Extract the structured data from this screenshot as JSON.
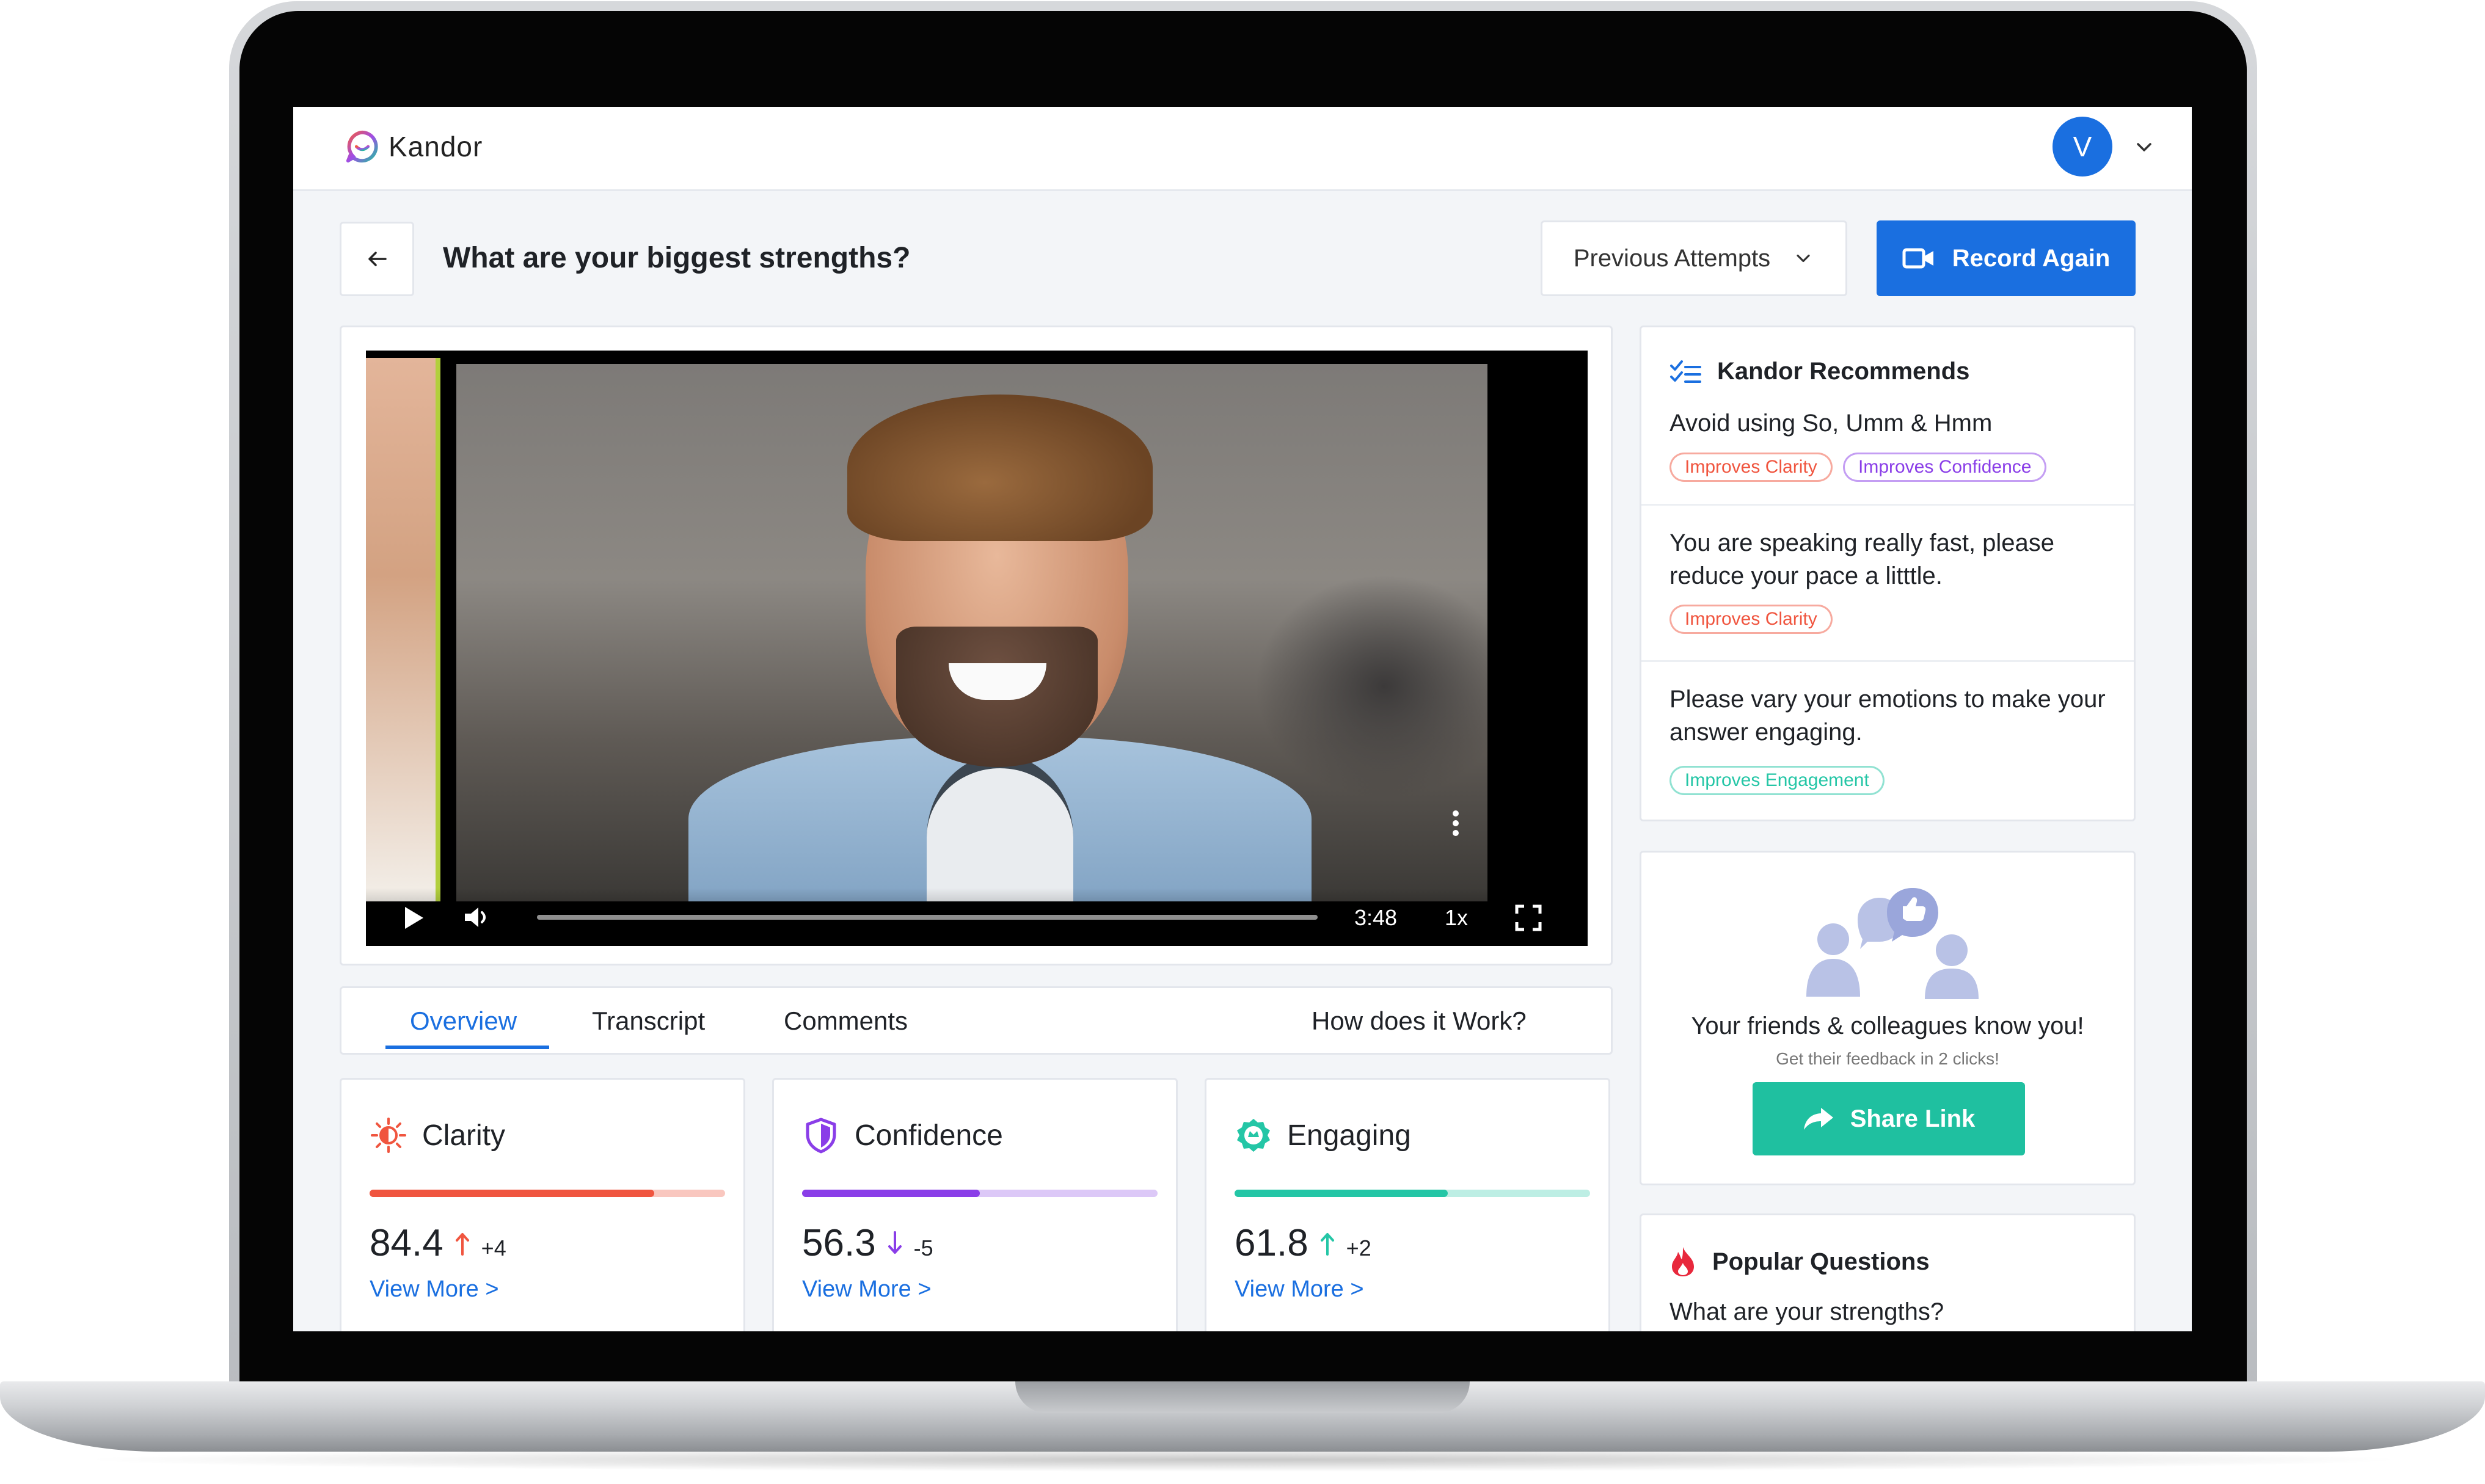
{
  "app": {
    "name": "Kandor",
    "user_initial": "V"
  },
  "header": {
    "question": "What are your biggest strengths?",
    "previous_attempts_label": "Previous Attempts",
    "record_again_label": "Record Again"
  },
  "video": {
    "time": "3:48",
    "speed": "1x"
  },
  "tabs": [
    {
      "label": "Overview",
      "active": true
    },
    {
      "label": "Transcript",
      "active": false
    },
    {
      "label": "Comments",
      "active": false
    },
    {
      "label": "How does it Work?",
      "active": false
    }
  ],
  "metrics": [
    {
      "name": "Clarity",
      "score": "84.4",
      "trend": "up",
      "delta": "+4",
      "bar_fraction": 0.8,
      "color": "#f0553f",
      "track_color": "#f9c7bf",
      "arrow_color": "#f0553f",
      "link": "View More >"
    },
    {
      "name": "Confidence",
      "score": "56.3",
      "trend": "down",
      "delta": "-5",
      "bar_fraction": 0.5,
      "color": "#8a3ee8",
      "track_color": "#dcc8f7",
      "arrow_color": "#8a3ee8",
      "link": "View More >"
    },
    {
      "name": "Engaging",
      "score": "61.8",
      "trend": "up",
      "delta": "+2",
      "bar_fraction": 0.6,
      "color": "#24c6a6",
      "track_color": "#bdeee4",
      "arrow_color": "#24c6a6",
      "link": "View More >"
    }
  ],
  "recommendations": {
    "title": "Kandor Recommends",
    "items": [
      {
        "text": "Avoid using So, Umm & Hmm",
        "tags": [
          {
            "label": "Improves Clarity",
            "color": "#f0553f"
          },
          {
            "label": "Improves Confidence",
            "color": "#8a3ee8"
          }
        ]
      },
      {
        "text": "You are speaking really fast, please reduce your pace a litttle.",
        "tags": [
          {
            "label": "Improves Clarity",
            "color": "#f0553f"
          }
        ]
      },
      {
        "text": "Please vary your emotions to make your answer engaging.",
        "tags": [
          {
            "label": "Improves Engagement",
            "color": "#24c6a6"
          }
        ]
      }
    ]
  },
  "share": {
    "title": "Your friends & colleagues know you!",
    "subtitle": "Get their feedback in 2 clicks!",
    "button_label": "Share Link"
  },
  "popular": {
    "title": "Popular Questions",
    "first_question": "What are your strengths?"
  },
  "colors": {
    "accent": "#1a6fe0",
    "share": "#1fc0a0",
    "popular_icon": "#e8283c"
  }
}
